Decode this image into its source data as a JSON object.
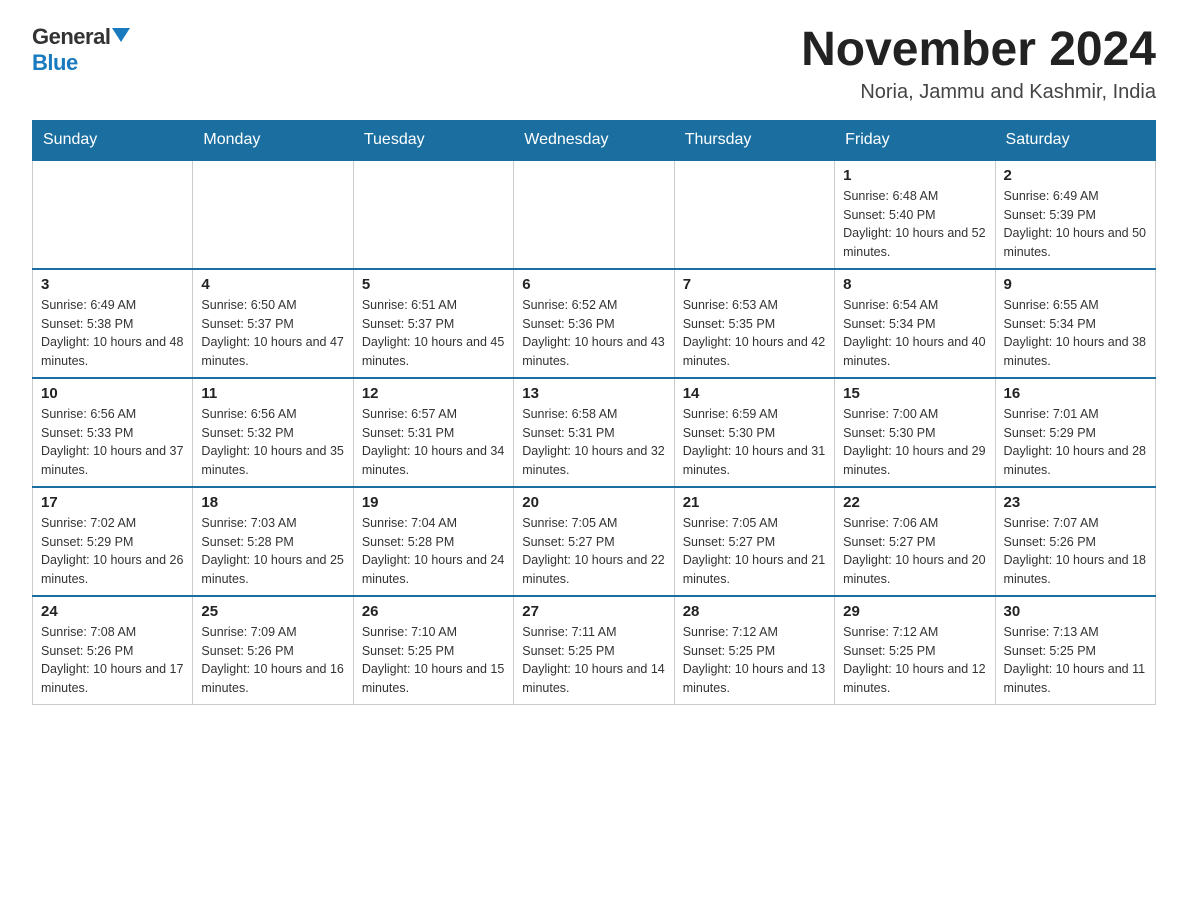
{
  "logo": {
    "general": "General",
    "blue": "Blue"
  },
  "title": "November 2024",
  "location": "Noria, Jammu and Kashmir, India",
  "days_of_week": [
    "Sunday",
    "Monday",
    "Tuesday",
    "Wednesday",
    "Thursday",
    "Friday",
    "Saturday"
  ],
  "weeks": [
    [
      {
        "day": "",
        "info": ""
      },
      {
        "day": "",
        "info": ""
      },
      {
        "day": "",
        "info": ""
      },
      {
        "day": "",
        "info": ""
      },
      {
        "day": "",
        "info": ""
      },
      {
        "day": "1",
        "info": "Sunrise: 6:48 AM\nSunset: 5:40 PM\nDaylight: 10 hours and 52 minutes."
      },
      {
        "day": "2",
        "info": "Sunrise: 6:49 AM\nSunset: 5:39 PM\nDaylight: 10 hours and 50 minutes."
      }
    ],
    [
      {
        "day": "3",
        "info": "Sunrise: 6:49 AM\nSunset: 5:38 PM\nDaylight: 10 hours and 48 minutes."
      },
      {
        "day": "4",
        "info": "Sunrise: 6:50 AM\nSunset: 5:37 PM\nDaylight: 10 hours and 47 minutes."
      },
      {
        "day": "5",
        "info": "Sunrise: 6:51 AM\nSunset: 5:37 PM\nDaylight: 10 hours and 45 minutes."
      },
      {
        "day": "6",
        "info": "Sunrise: 6:52 AM\nSunset: 5:36 PM\nDaylight: 10 hours and 43 minutes."
      },
      {
        "day": "7",
        "info": "Sunrise: 6:53 AM\nSunset: 5:35 PM\nDaylight: 10 hours and 42 minutes."
      },
      {
        "day": "8",
        "info": "Sunrise: 6:54 AM\nSunset: 5:34 PM\nDaylight: 10 hours and 40 minutes."
      },
      {
        "day": "9",
        "info": "Sunrise: 6:55 AM\nSunset: 5:34 PM\nDaylight: 10 hours and 38 minutes."
      }
    ],
    [
      {
        "day": "10",
        "info": "Sunrise: 6:56 AM\nSunset: 5:33 PM\nDaylight: 10 hours and 37 minutes."
      },
      {
        "day": "11",
        "info": "Sunrise: 6:56 AM\nSunset: 5:32 PM\nDaylight: 10 hours and 35 minutes."
      },
      {
        "day": "12",
        "info": "Sunrise: 6:57 AM\nSunset: 5:31 PM\nDaylight: 10 hours and 34 minutes."
      },
      {
        "day": "13",
        "info": "Sunrise: 6:58 AM\nSunset: 5:31 PM\nDaylight: 10 hours and 32 minutes."
      },
      {
        "day": "14",
        "info": "Sunrise: 6:59 AM\nSunset: 5:30 PM\nDaylight: 10 hours and 31 minutes."
      },
      {
        "day": "15",
        "info": "Sunrise: 7:00 AM\nSunset: 5:30 PM\nDaylight: 10 hours and 29 minutes."
      },
      {
        "day": "16",
        "info": "Sunrise: 7:01 AM\nSunset: 5:29 PM\nDaylight: 10 hours and 28 minutes."
      }
    ],
    [
      {
        "day": "17",
        "info": "Sunrise: 7:02 AM\nSunset: 5:29 PM\nDaylight: 10 hours and 26 minutes."
      },
      {
        "day": "18",
        "info": "Sunrise: 7:03 AM\nSunset: 5:28 PM\nDaylight: 10 hours and 25 minutes."
      },
      {
        "day": "19",
        "info": "Sunrise: 7:04 AM\nSunset: 5:28 PM\nDaylight: 10 hours and 24 minutes."
      },
      {
        "day": "20",
        "info": "Sunrise: 7:05 AM\nSunset: 5:27 PM\nDaylight: 10 hours and 22 minutes."
      },
      {
        "day": "21",
        "info": "Sunrise: 7:05 AM\nSunset: 5:27 PM\nDaylight: 10 hours and 21 minutes."
      },
      {
        "day": "22",
        "info": "Sunrise: 7:06 AM\nSunset: 5:27 PM\nDaylight: 10 hours and 20 minutes."
      },
      {
        "day": "23",
        "info": "Sunrise: 7:07 AM\nSunset: 5:26 PM\nDaylight: 10 hours and 18 minutes."
      }
    ],
    [
      {
        "day": "24",
        "info": "Sunrise: 7:08 AM\nSunset: 5:26 PM\nDaylight: 10 hours and 17 minutes."
      },
      {
        "day": "25",
        "info": "Sunrise: 7:09 AM\nSunset: 5:26 PM\nDaylight: 10 hours and 16 minutes."
      },
      {
        "day": "26",
        "info": "Sunrise: 7:10 AM\nSunset: 5:25 PM\nDaylight: 10 hours and 15 minutes."
      },
      {
        "day": "27",
        "info": "Sunrise: 7:11 AM\nSunset: 5:25 PM\nDaylight: 10 hours and 14 minutes."
      },
      {
        "day": "28",
        "info": "Sunrise: 7:12 AM\nSunset: 5:25 PM\nDaylight: 10 hours and 13 minutes."
      },
      {
        "day": "29",
        "info": "Sunrise: 7:12 AM\nSunset: 5:25 PM\nDaylight: 10 hours and 12 minutes."
      },
      {
        "day": "30",
        "info": "Sunrise: 7:13 AM\nSunset: 5:25 PM\nDaylight: 10 hours and 11 minutes."
      }
    ]
  ]
}
